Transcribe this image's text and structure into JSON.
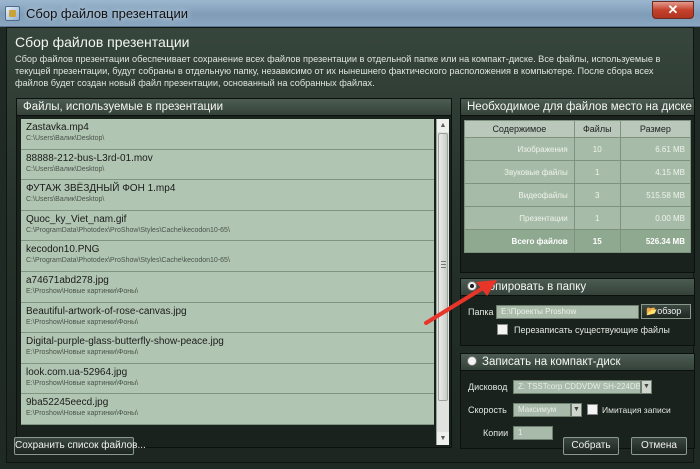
{
  "window": {
    "title": "Сбор файлов презентации",
    "close_glyph": "✕"
  },
  "header": {
    "title": "Сбор файлов презентации",
    "description": "Сбор файлов презентации обеспечивает сохранение всех файлов презентации в отдельной папке или на компакт-диске. Все файлы, используемые в текущей презентации, будут собраны в отдельную папку, независимо от их нынешнего фактического расположения в компьютере. После сбора всех файлов будет создан новый файл презентации, основанный на собранных файлах."
  },
  "files_panel": {
    "title": "Файлы, используемые в презентации",
    "items": [
      {
        "name": "Zastavka.mp4",
        "path": "C:\\Users\\Валик\\Desktop\\"
      },
      {
        "name": "88888-212-bus-L3rd-01.mov",
        "path": "C:\\Users\\Валик\\Desktop\\"
      },
      {
        "name": "ФУТАЖ ЗВЁЗДНЫЙ ФОН 1.mp4",
        "path": "C:\\Users\\Валик\\Desktop\\"
      },
      {
        "name": "Quoc_ky_Viet_nam.gif",
        "path": "C:\\ProgramData\\Photodex\\ProShow\\Styles\\Cache\\kecodon10-65\\"
      },
      {
        "name": "kecodon10.PNG",
        "path": "C:\\ProgramData\\Photodex\\ProShow\\Styles\\Cache\\kecodon10-65\\"
      },
      {
        "name": "a74671abd278.jpg",
        "path": "E:\\Proshow\\Новые картинки\\Фоны\\"
      },
      {
        "name": "Beautiful-artwork-of-rose-canvas.jpg",
        "path": "E:\\Proshow\\Новые картинки\\Фоны\\"
      },
      {
        "name": "Digital-purple-glass-butterfly-show-peace.jpg",
        "path": "E:\\Proshow\\Новые картинки\\Фоны\\"
      },
      {
        "name": "look.com.ua-52964.jpg",
        "path": "E:\\Proshow\\Новые картинки\\Фоны\\"
      },
      {
        "name": "9ba52245eecd.jpg",
        "path": "E:\\Proshow\\Новые картинки\\Фоны\\"
      }
    ]
  },
  "disk_space": {
    "title": "Необходимое для файлов место на диске",
    "columns": [
      "Содержимое",
      "Файлы",
      "Размер"
    ],
    "rows": [
      {
        "label": "Изображения",
        "files": "10",
        "size": "6.61 MB"
      },
      {
        "label": "Звуковые файлы",
        "files": "1",
        "size": "4.15 MB"
      },
      {
        "label": "Видеофайлы",
        "files": "3",
        "size": "515.58 MB"
      },
      {
        "label": "Презентации",
        "files": "1",
        "size": "0.00 MB"
      }
    ],
    "total": {
      "label": "Всего файлов",
      "files": "15",
      "size": "526.34 MB"
    }
  },
  "copy_section": {
    "title": "Копировать в папку",
    "folder_label": "Папка",
    "folder_value": "E:\\Проекты Proshow",
    "browse_label": "обзор",
    "overwrite_label": "Перезаписать существующие файлы"
  },
  "burn_section": {
    "title": "Записать на компакт-диск",
    "drive_label": "Дисковод",
    "drive_value": "Z: TSSTcorp CDDVDW SH-224DB",
    "speed_label": "Скорость",
    "speed_value": "Максимум",
    "simulate_label": "Имитация записи",
    "copies_label": "Копии",
    "copies_value": "1"
  },
  "buttons": {
    "save_list": "Сохранить список файлов...",
    "collect": "Собрать",
    "cancel": "Отмена"
  },
  "colors": {
    "annotation_arrow": "#e8352a",
    "panel_head": "#4c5c52",
    "list_item": "#b1c6b2"
  }
}
